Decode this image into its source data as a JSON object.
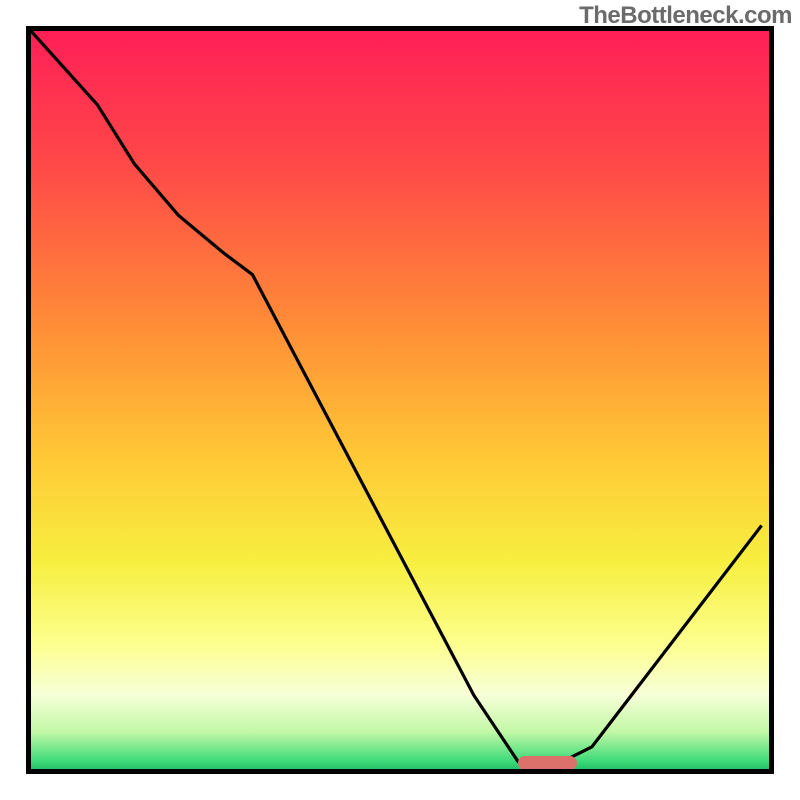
{
  "watermark": "TheBottleneck.com",
  "colors": {
    "border": "#000000",
    "curve": "#000000",
    "marker": "#db716a",
    "gradient_stops": [
      {
        "pct": 0,
        "color": "#ff1f57"
      },
      {
        "pct": 18,
        "color": "#ff4848"
      },
      {
        "pct": 40,
        "color": "#ff8d37"
      },
      {
        "pct": 58,
        "color": "#ffc936"
      },
      {
        "pct": 72,
        "color": "#f7ef40"
      },
      {
        "pct": 83,
        "color": "#fdff8e"
      },
      {
        "pct": 90,
        "color": "#f7ffd8"
      },
      {
        "pct": 95,
        "color": "#c1f8a5"
      },
      {
        "pct": 99,
        "color": "#3bd978"
      },
      {
        "pct": 100,
        "color": "#28c06a"
      }
    ]
  },
  "chart_data": {
    "type": "line",
    "title": "",
    "xlabel": "",
    "ylabel": "",
    "xlim": [
      0,
      100
    ],
    "ylim": [
      0,
      100
    ],
    "x": [
      0,
      9,
      14,
      20,
      26,
      30,
      60,
      66,
      72,
      76,
      99
    ],
    "values": [
      100,
      90,
      82,
      75,
      70,
      67,
      10,
      1,
      1,
      3,
      33
    ],
    "marker": {
      "x_start": 66,
      "x_end": 74,
      "y": 0.8
    },
    "note": "Values read off plot; axes are unlabeled in source image, treated as 0-100 in both directions."
  }
}
